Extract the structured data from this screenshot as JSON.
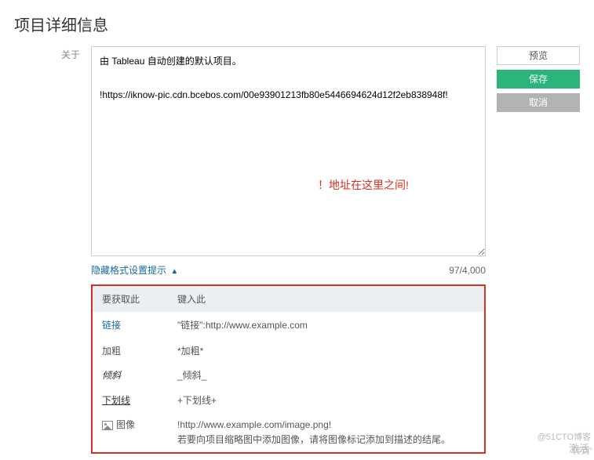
{
  "title": "项目详细信息",
  "about": {
    "label": "关于",
    "text": "由 Tableau 自动创建的默认项目。\n\n!https://iknow-pic.cdn.bcebos.com/00e93901213fb80e5446694624d12f2eb838948f!"
  },
  "buttons": {
    "preview": "预览",
    "save": "保存",
    "cancel": "取消"
  },
  "hideHint": "隐藏格式设置提示",
  "counter": "97/4,000",
  "annotation": "！地址在这里之间!",
  "hints": {
    "header_left": "要获取此",
    "header_right": "键入此",
    "rows": [
      {
        "label": "链接",
        "labelClass": "link-label",
        "value": "\"链接\":http://www.example.com"
      },
      {
        "label": "加粗",
        "labelClass": "",
        "value": "*加粗*"
      },
      {
        "label": "倾斜",
        "labelClass": "italic-label",
        "value": "_倾斜_"
      },
      {
        "label": "下划线",
        "labelClass": "underline-label",
        "value": "+下划线+"
      },
      {
        "label": "图像",
        "labelClass": "",
        "value": "!http://www.example.com/image.png!\n若要向项目缩略图中添加图像，请将图像标记添加到描述的结尾。",
        "icon": true
      }
    ]
  },
  "watermarks": {
    "w1": "@51CTO博客",
    "w2": "激活",
    "w3": "转到\""
  }
}
